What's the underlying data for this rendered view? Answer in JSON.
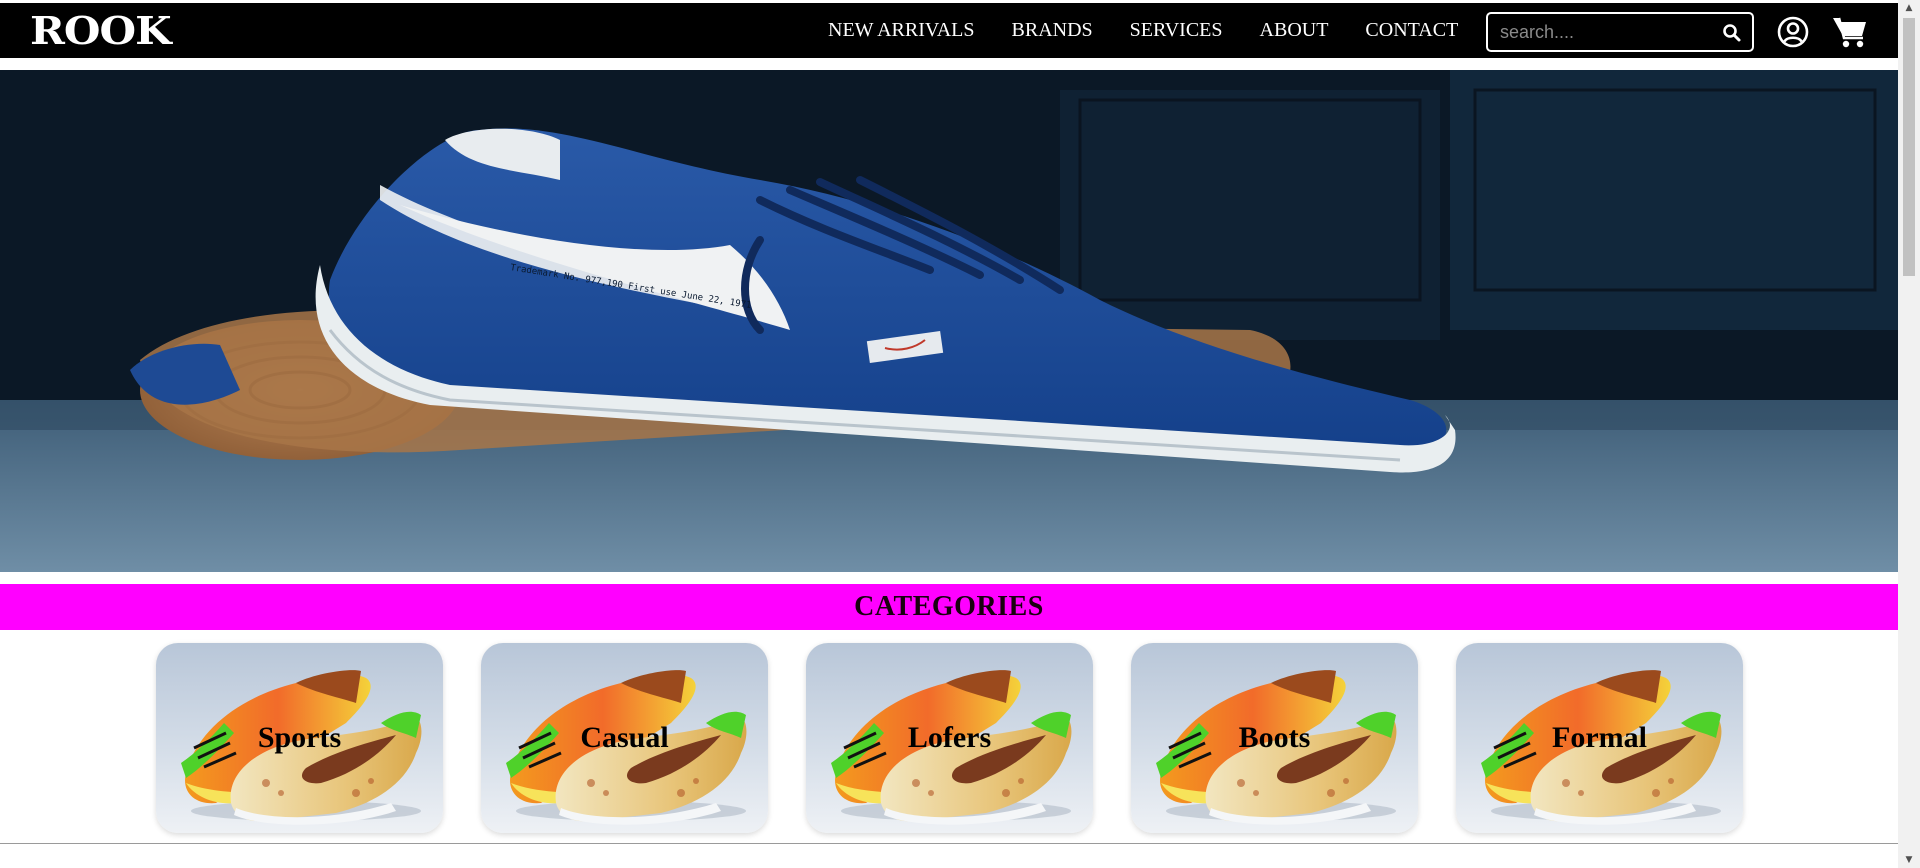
{
  "brand": {
    "logo_text": "ROOK"
  },
  "nav": {
    "links": [
      "NEW ARRIVALS",
      "BRANDS",
      "SERVICES",
      "ABOUT",
      "CONTACT"
    ]
  },
  "search": {
    "placeholder": "search....",
    "value": ""
  },
  "icons": {
    "search": "search-icon",
    "user": "user-circle-icon",
    "cart": "shopping-cart-icon"
  },
  "hero": {
    "image": "blue-sneaker-photo",
    "shoe_print": "Trademark No. 977,190 First use June 22, 1971"
  },
  "categories": {
    "title": "CATEGORIES",
    "items": [
      {
        "label": "Sports"
      },
      {
        "label": "Casual"
      },
      {
        "label": "Lofers"
      },
      {
        "label": "Boots"
      },
      {
        "label": "Formal"
      }
    ]
  },
  "colors": {
    "navbar": "#000000",
    "category_bar": "#ff00ff",
    "text_light": "#ffffff"
  }
}
